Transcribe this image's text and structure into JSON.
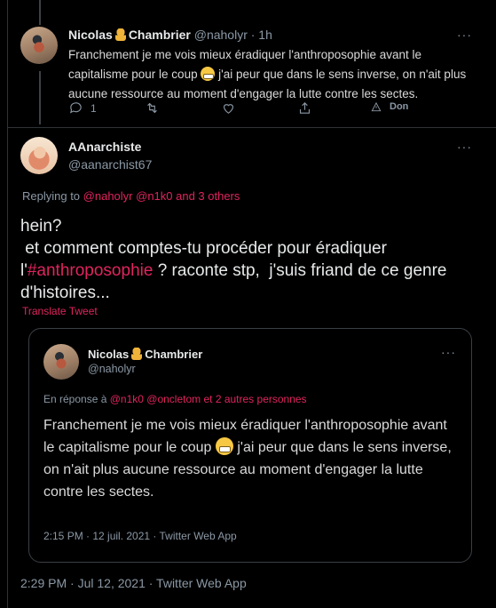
{
  "first_tweet": {
    "name": "Nicolas",
    "name_suffix": "Chambrier",
    "handle_time": "@naholyr · 1h",
    "text_part1": "Franchement je me vois mieux éradiquer l'anthroposophie avant le capitalisme pour le coup",
    "text_part2": "j'ai peur que dans le sens inverse, on n'ait plus aucune ressource au moment d'engager la lutte contre les sectes.",
    "reply_count": "1",
    "donate_label": "Don"
  },
  "main_tweet": {
    "name": "AAnarchiste",
    "handle": "@aanarchist67",
    "replying_prefix": "Replying to",
    "replying_links": "@naholyr @n1k0 and 3 others",
    "text_line1": "hein?",
    "text_line2": " et comment comptes-tu procéder pour éradiquer",
    "text_prefix": "l'",
    "hashtag": "#anthroposophie",
    "text_after": " ? raconte stp,  j'suis friand de ce genre d'histoires...",
    "translate_label": "Translate Tweet",
    "timestamp": "2:29 PM · Jul 12, 2021 · Twitter Web App"
  },
  "quoted_tweet": {
    "name": "Nicolas",
    "name_suffix": "Chambrier",
    "handle": "@naholyr",
    "reply_prefix": "En réponse à",
    "reply_links": "@n1k0 @oncletom  et 2 autres personnes",
    "text_part1": "Franchement je me vois mieux éradiquer l'anthroposophie avant le capitalisme pour le coup",
    "text_part2": "j'ai peur que dans le sens inverse, on n'ait plus aucune ressource au moment d'engager la lutte contre les sectes.",
    "timestamp": "2:15 PM · 12 juil. 2021 · Twitter Web App"
  },
  "more_glyph": "···",
  "colors": {
    "accent": "#e0245e",
    "background": "#000000",
    "muted": "#8b98a5"
  }
}
